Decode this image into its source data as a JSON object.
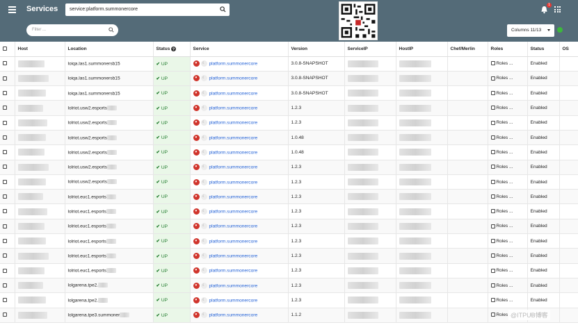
{
  "header": {
    "menu_icon": "hamburger-icon",
    "title": "Services",
    "search_value": "service:platform.summonercore",
    "notification_count": "1",
    "apps_icon": "grid-icon"
  },
  "toolbar": {
    "filter_placeholder": "Filter ...",
    "columns_label": "Columns 11/13"
  },
  "table": {
    "headers": [
      "Host",
      "Location",
      "Status",
      "Service",
      "Version",
      "ServiceIP",
      "HostIP",
      "Chef/Merlin",
      "Roles",
      "Status",
      "OS"
    ],
    "rows": [
      {
        "location": "loiqa.las1.summonersb15",
        "status": "UP",
        "service": "platform.summonercore",
        "version": "3.0.8-SNAPSHOT",
        "roles": "Roles ...",
        "state": "Enabled"
      },
      {
        "location": "loiqa.las1.summonersb15",
        "status": "UP",
        "service": "platform.summonercore",
        "version": "3.0.8-SNAPSHOT",
        "roles": "Roles ...",
        "state": "Enabled"
      },
      {
        "location": "loiqa.las1.summonersb15",
        "status": "UP",
        "service": "platform.summonercore",
        "version": "3.0.8-SNAPSHOT",
        "roles": "Roles ...",
        "state": "Enabled"
      },
      {
        "location": "lolriot.usw2.esports",
        "status": "UP",
        "service": "platform.summonercore",
        "version": "1.2.3",
        "roles": "Roles ...",
        "state": "Enabled"
      },
      {
        "location": "lolriot.usw2.esports",
        "status": "UP",
        "service": "platform.summonercore",
        "version": "1.2.3",
        "roles": "Roles ...",
        "state": "Enabled"
      },
      {
        "location": "lolriot.usw2.esports",
        "status": "UP",
        "service": "platform.summonercore",
        "version": "1.0.48",
        "roles": "Roles ...",
        "state": "Enabled"
      },
      {
        "location": "lolriot.usw2.esports",
        "status": "UP",
        "service": "platform.summonercore",
        "version": "1.0.48",
        "roles": "Roles ...",
        "state": "Enabled"
      },
      {
        "location": "lolriot.usw2.esports",
        "status": "UP",
        "service": "platform.summonercore",
        "version": "1.2.3",
        "roles": "Roles ...",
        "state": "Enabled"
      },
      {
        "location": "lolriot.usw2.esports",
        "status": "UP",
        "service": "platform.summonercore",
        "version": "1.2.3",
        "roles": "Roles ...",
        "state": "Enabled"
      },
      {
        "location": "lolriot.euc1.esports",
        "status": "UP",
        "service": "platform.summonercore",
        "version": "1.2.3",
        "roles": "Roles ...",
        "state": "Enabled"
      },
      {
        "location": "lolriot.euc1.esports",
        "status": "UP",
        "service": "platform.summonercore",
        "version": "1.2.3",
        "roles": "Roles ...",
        "state": "Enabled"
      },
      {
        "location": "lolriot.euc1.esports",
        "status": "UP",
        "service": "platform.summonercore",
        "version": "1.2.3",
        "roles": "Roles ...",
        "state": "Enabled"
      },
      {
        "location": "lolriot.euc1.esports",
        "status": "UP",
        "service": "platform.summonercore",
        "version": "1.2.3",
        "roles": "Roles ...",
        "state": "Enabled"
      },
      {
        "location": "lolriot.euc1.esports",
        "status": "UP",
        "service": "platform.summonercore",
        "version": "1.2.3",
        "roles": "Roles ...",
        "state": "Enabled"
      },
      {
        "location": "lolriot.euc1.esports",
        "status": "UP",
        "service": "platform.summonercore",
        "version": "1.2.3",
        "roles": "Roles ...",
        "state": "Enabled"
      },
      {
        "location": "lolgarena.tpe2.",
        "status": "UP",
        "service": "platform.summonercore",
        "version": "1.2.3",
        "roles": "Roles ...",
        "state": "Enabled"
      },
      {
        "location": "lolgarena.tpe2.",
        "status": "UP",
        "service": "platform.summonercore",
        "version": "1.2.3",
        "roles": "Roles ...",
        "state": "Enabled"
      },
      {
        "location": "lolgarena.tpe3.summoner",
        "status": "UP",
        "service": "platform.summonercore",
        "version": "1.1.2",
        "roles": "Roles ...",
        "state": "Enabled"
      }
    ]
  },
  "watermark": "@ITPUB博客",
  "colors": {
    "header_bg": "#546b78",
    "status_up": "#1e7a2a",
    "link": "#1f5fd6",
    "service_badge": "#d0342c",
    "online_dot": "#3cb83c"
  }
}
